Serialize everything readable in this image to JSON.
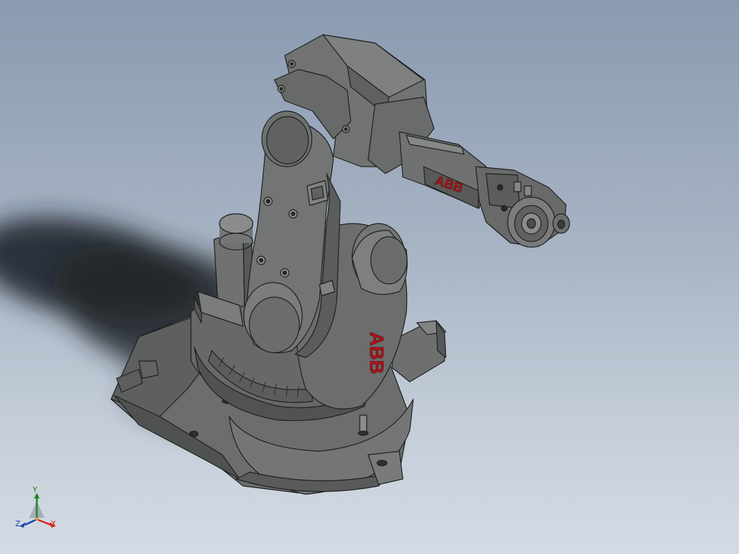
{
  "viewport": {
    "background_top": "#8a9ab0",
    "background_bottom": "#d4dbe4"
  },
  "model": {
    "name_icon": "industrial-robot-arm",
    "body_color": "#6e7170",
    "edge_color": "#1e1e1e",
    "logo_color": "#b2141a",
    "logo_text_arm": "ABB",
    "logo_text_base": "ABB"
  },
  "triad": {
    "x_label": "X",
    "y_label": "Y",
    "z_label": "Z",
    "x_color": "#d8201c",
    "y_color": "#1b8a1b",
    "z_color": "#1c3fb0"
  }
}
